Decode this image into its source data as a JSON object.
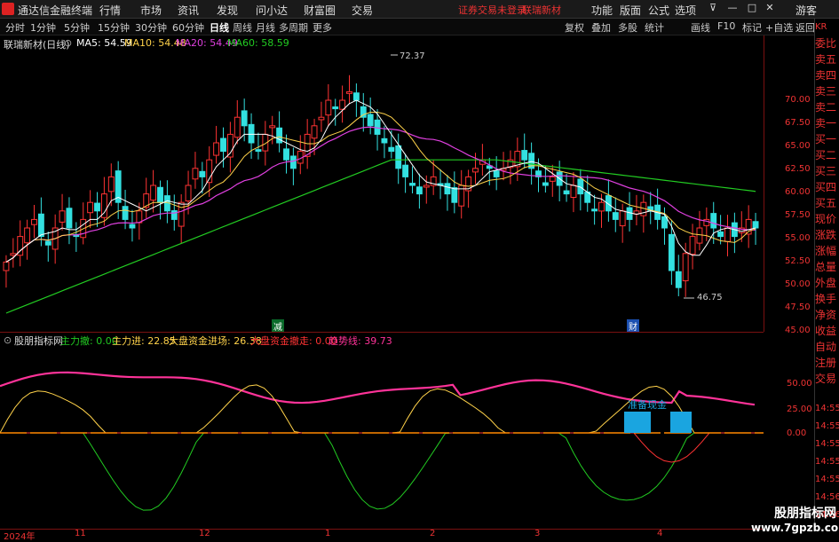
{
  "menubar": {
    "title": "通达信金融终端",
    "items": [
      "行情",
      "市场",
      "资讯",
      "发现",
      "问小达",
      "财富圈",
      "交易"
    ],
    "status": "证券交易未登录",
    "stock_tag": "联瑞新材",
    "tools": [
      "功能",
      "版面",
      "公式",
      "选项"
    ],
    "guest": "游客"
  },
  "periodbar": {
    "periods": [
      "分时",
      "1分钟",
      "5分钟",
      "15分钟",
      "30分钟",
      "60分钟",
      "日线",
      "周线",
      "月线",
      "多周期",
      "更多"
    ],
    "active_index": 6,
    "right_tools": [
      "复权",
      "叠加",
      "多股",
      "统计",
      "画线",
      "F10",
      "标记",
      "+自选",
      "返回"
    ]
  },
  "main_chart": {
    "stock_label": "联瑞新材(日线)",
    "ma": [
      {
        "label": "MA5: 54.59",
        "color": "#ffffff"
      },
      {
        "label": "MA10: 54.48",
        "color": "#ffd24a"
      },
      {
        "label": "MA20: 54.49",
        "color": "#e040e0"
      },
      {
        "label": "MA60: 58.59",
        "color": "#22cc22"
      }
    ],
    "y_ticks": [
      "70.00",
      "67.50",
      "65.00",
      "62.50",
      "60.00",
      "57.50",
      "55.00",
      "52.50",
      "50.00",
      "47.50",
      "45.00"
    ],
    "high_label": "72.37",
    "low_label": "46.75",
    "markers": [
      "减",
      "财"
    ]
  },
  "indicator": {
    "name": "股朋指标网",
    "items": [
      {
        "label": "主力撤: 0.00",
        "color": "#22cc22"
      },
      {
        "label": "主力进: 22.85",
        "color": "#ffd24a"
      },
      {
        "label": "大盘资金进场: 26.38",
        "color": "#ffd24a"
      },
      {
        "label": "大盘资金撤走: 0.00",
        "color": "#ff3333"
      },
      {
        "label": "趋势线: 39.73",
        "color": "#ff3399"
      }
    ],
    "y_ticks": [
      "50.00",
      "25.00",
      "0.00"
    ],
    "signal_text": "准备现金"
  },
  "right_panel": {
    "header": "KR",
    "rows": [
      "委比",
      "卖五",
      "卖四",
      "卖三",
      "卖二",
      "卖一",
      "买一",
      "买二",
      "买三",
      "买四",
      "买五",
      "现价",
      "涨跌",
      "涨幅",
      "总量",
      "外盘",
      "换手",
      "净资",
      "收益",
      "自动",
      "注册",
      "交易"
    ],
    "times": [
      "14:55",
      "14:55",
      "14:55",
      "14:55",
      "14:55",
      "14:56",
      "14:56"
    ]
  },
  "timeline": {
    "dates": [
      "2024年",
      "11",
      "12",
      "1",
      "2",
      "3",
      "4"
    ]
  },
  "watermark": {
    "line1": "股朋指标网",
    "line2": "www.7gpzb.com"
  }
}
